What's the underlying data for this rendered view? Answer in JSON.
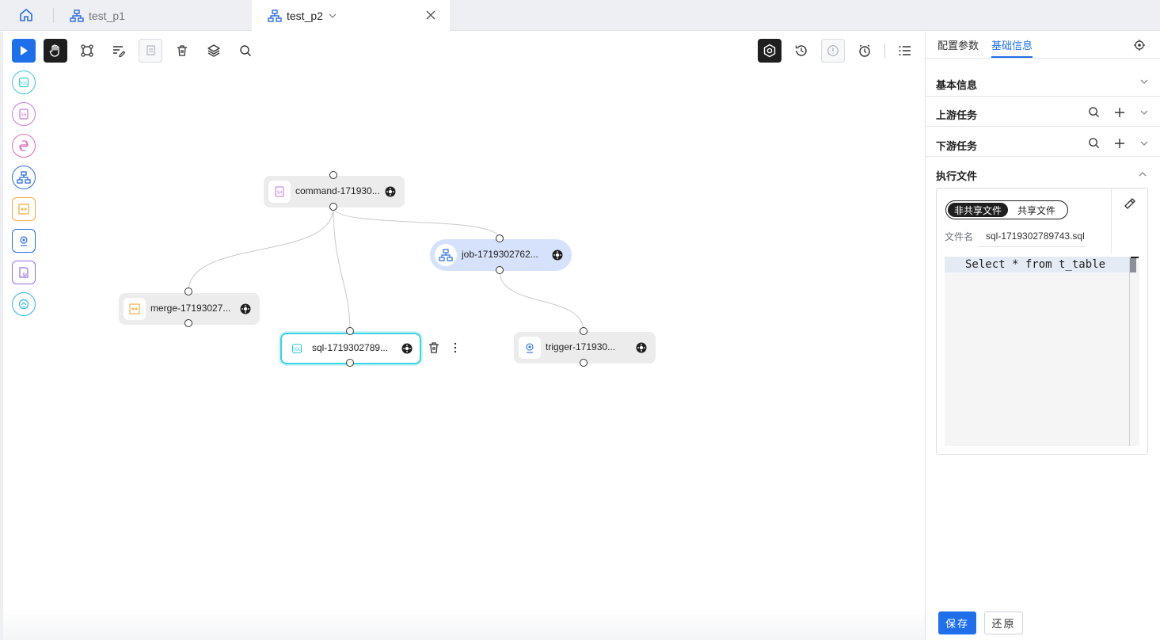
{
  "tabs": [
    {
      "label": "test_p1",
      "icon": "workflow-icon"
    },
    {
      "label": "test_p2",
      "icon": "workflow-icon",
      "active": true
    }
  ],
  "toolbar": {
    "left": [
      "play-icon",
      "hand-icon",
      "select-nodes-icon",
      "format-icon",
      "copy-icon",
      "trash-icon",
      "layers-icon",
      "search-icon"
    ],
    "right": [
      "settings-icon",
      "history-icon",
      "info-icon",
      "alarm-icon",
      "list-icon"
    ]
  },
  "palette": [
    {
      "icon": "sql-icon",
      "color": "#39c8d8"
    },
    {
      "icon": "shell-icon",
      "color": "#c27ad8"
    },
    {
      "icon": "python-icon",
      "color": "#e06ab8"
    },
    {
      "icon": "job-icon",
      "color": "#2b6be0"
    },
    {
      "icon": "merge-icon",
      "color": "#f0a93a"
    },
    {
      "icon": "trigger-icon",
      "color": "#2b6be0"
    },
    {
      "icon": "custom-icon",
      "color": "#9a6de0"
    },
    {
      "icon": "api-icon",
      "color": "#2fb7e0"
    }
  ],
  "nodes": {
    "command": "command-171930...",
    "job": "job-1719302762...",
    "merge": "merge-17193027...",
    "sql": "sql-1719302789...",
    "trigger": "trigger-171930..."
  },
  "panel": {
    "tabs": [
      "配置参数",
      "基础信息"
    ],
    "active_tab": "基础信息",
    "sections": {
      "basic": "基本信息",
      "upstream": "上游任务",
      "downstream": "下游任务",
      "exec_file": "执行文件"
    },
    "file": {
      "segment_on": "非共享文件",
      "segment_off": "共享文件",
      "name_label": "文件名",
      "name_value": "sql-1719302789743.sql",
      "code": "Select * from t_table"
    },
    "save": "保存",
    "reset": "还原"
  },
  "colors": {
    "accent": "#1f6feb",
    "sql_node_border": "#39d4e3",
    "job_node_bg": "#d6e2fb"
  }
}
